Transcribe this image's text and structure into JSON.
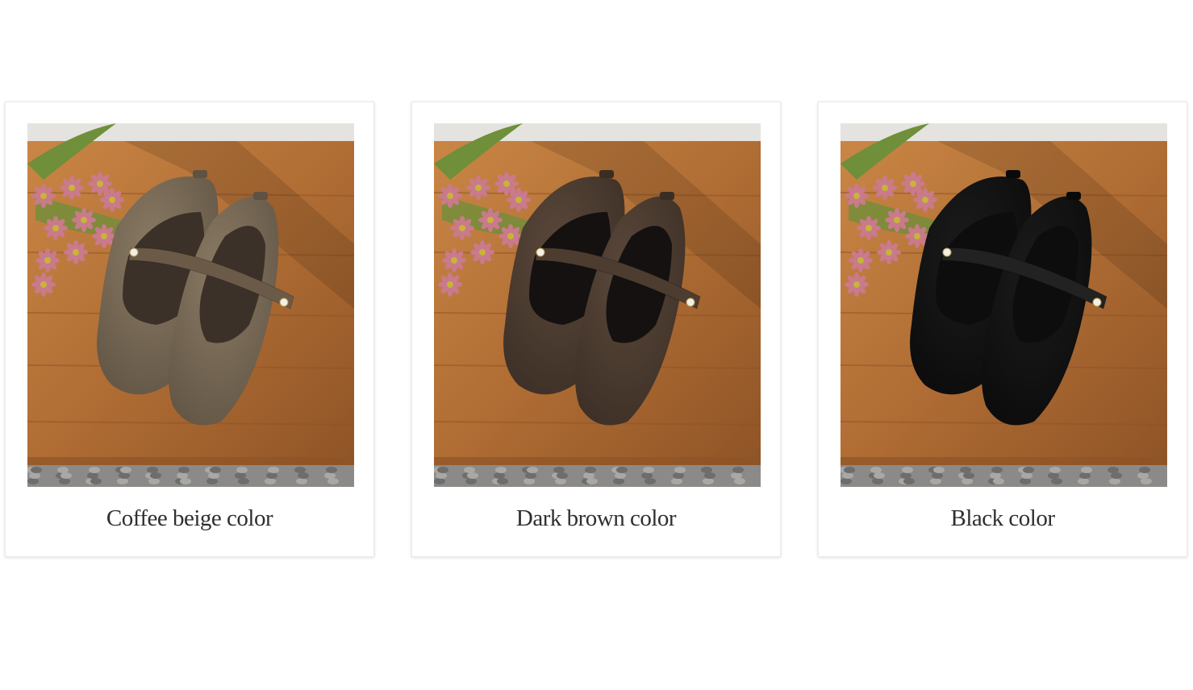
{
  "products": [
    {
      "caption": "Coffee beige color",
      "shoe_color": "#8a7a64",
      "shoe_shade": "#5e5242",
      "lining": "#3b3128",
      "strap": "#6b5a47"
    },
    {
      "caption": "Dark brown color",
      "shoe_color": "#5a483a",
      "shoe_shade": "#3a2d24",
      "lining": "#141110",
      "strap": "#4d3c30"
    },
    {
      "caption": "Black color",
      "shoe_color": "#1b1b1b",
      "shoe_shade": "#0a0a0a",
      "lining": "#0d0d0d",
      "strap": "#222222"
    }
  ],
  "scene": {
    "wall": "#e4e3df",
    "wood": "#b06d34",
    "wood_dark": "#8f5426",
    "wood_light": "#c98645",
    "gravel": "#8b8a88",
    "flower": "#c97a8b",
    "leaf": "#6f8f3a"
  }
}
